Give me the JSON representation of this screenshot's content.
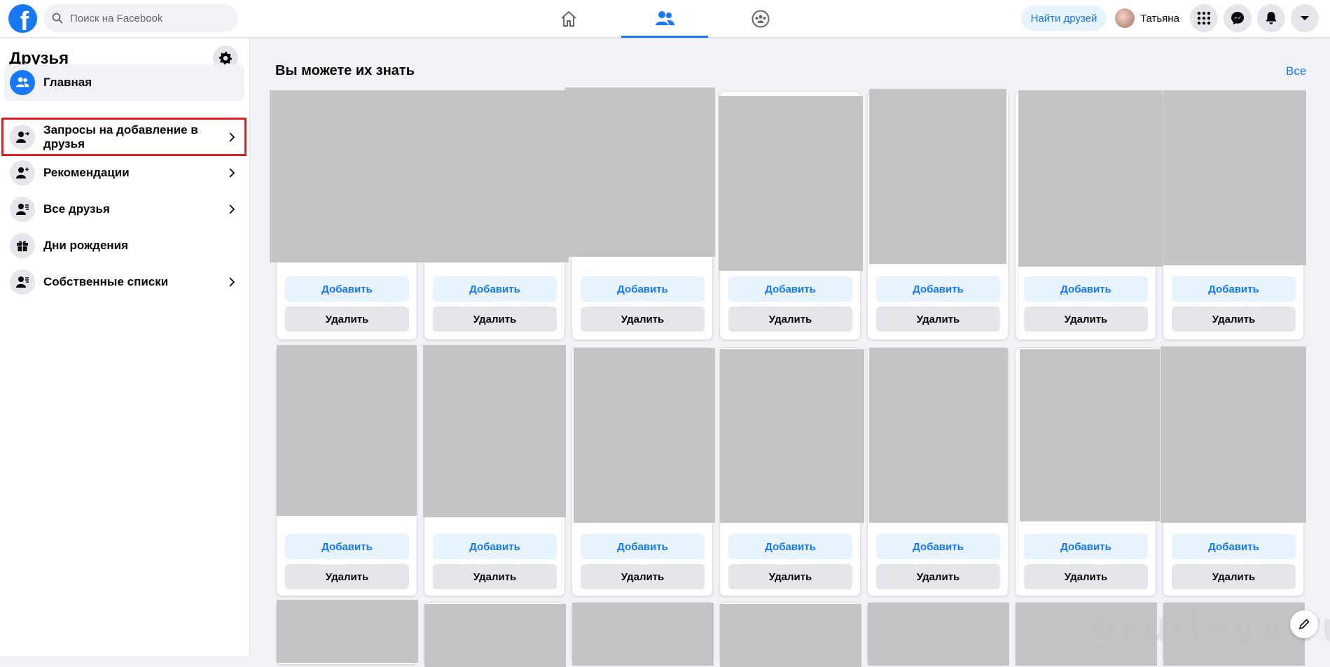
{
  "topbar": {
    "search_placeholder": "Поиск на Facebook",
    "find_friends": "Найти друзей",
    "user_name": "Татьяна",
    "nav": [
      {
        "icon": "home-icon"
      },
      {
        "icon": "friends-icon",
        "active": true
      },
      {
        "icon": "groups-icon"
      }
    ],
    "actions": [
      "menu-grid-icon",
      "messenger-icon",
      "bell-icon",
      "caret-down-icon"
    ]
  },
  "sidebar": {
    "title": "Друзья",
    "items": [
      {
        "label": "Главная",
        "icon": "friends-icon",
        "chevron": false,
        "active": true
      },
      {
        "label": "Запросы на добавление в друзья",
        "icon": "user-arrow-icon",
        "chevron": true,
        "highlighted": true
      },
      {
        "label": "Рекомендации",
        "icon": "user-plus-icon",
        "chevron": true
      },
      {
        "label": "Все друзья",
        "icon": "user-list-icon",
        "chevron": true
      },
      {
        "label": "Дни рождения",
        "icon": "gift-icon",
        "chevron": false
      },
      {
        "label": "Собственные списки",
        "icon": "user-list-icon",
        "chevron": true
      }
    ]
  },
  "main": {
    "title": "Вы можете их знать",
    "see_all": "Все",
    "card_buttons": {
      "add": "Добавить",
      "remove": "Удалить"
    }
  },
  "watermark": "grudeyv.ru",
  "colors": {
    "brand": "#1877f2",
    "highlight": "#e02020",
    "placeholder_photo": "#c4c3c5"
  }
}
